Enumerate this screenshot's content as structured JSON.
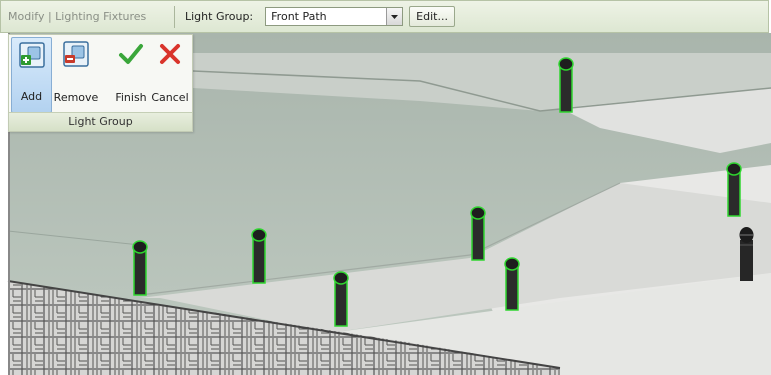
{
  "options_bar": {
    "context_title": "Modify | Lighting Fixtures",
    "light_group_label": "Light Group:",
    "light_group_value": "Front Path",
    "edit_label": "Edit..."
  },
  "ribbon": {
    "panel_title": "Light Group",
    "tools": [
      {
        "label": "Add",
        "icon": "add-light-icon",
        "active": true
      },
      {
        "label": "Remove",
        "icon": "remove-light-icon",
        "active": false
      },
      {
        "label": "Finish",
        "icon": "checkmark-icon",
        "active": false
      },
      {
        "label": "Cancel",
        "icon": "cancel-x-icon",
        "active": false
      }
    ]
  },
  "colors": {
    "options_bar_bg": "#e3eadb",
    "selection_highlight": "#2fd62f",
    "active_tool": "#b3d2f0",
    "finish_green": "#3aa63a",
    "cancel_red": "#d9342b"
  }
}
